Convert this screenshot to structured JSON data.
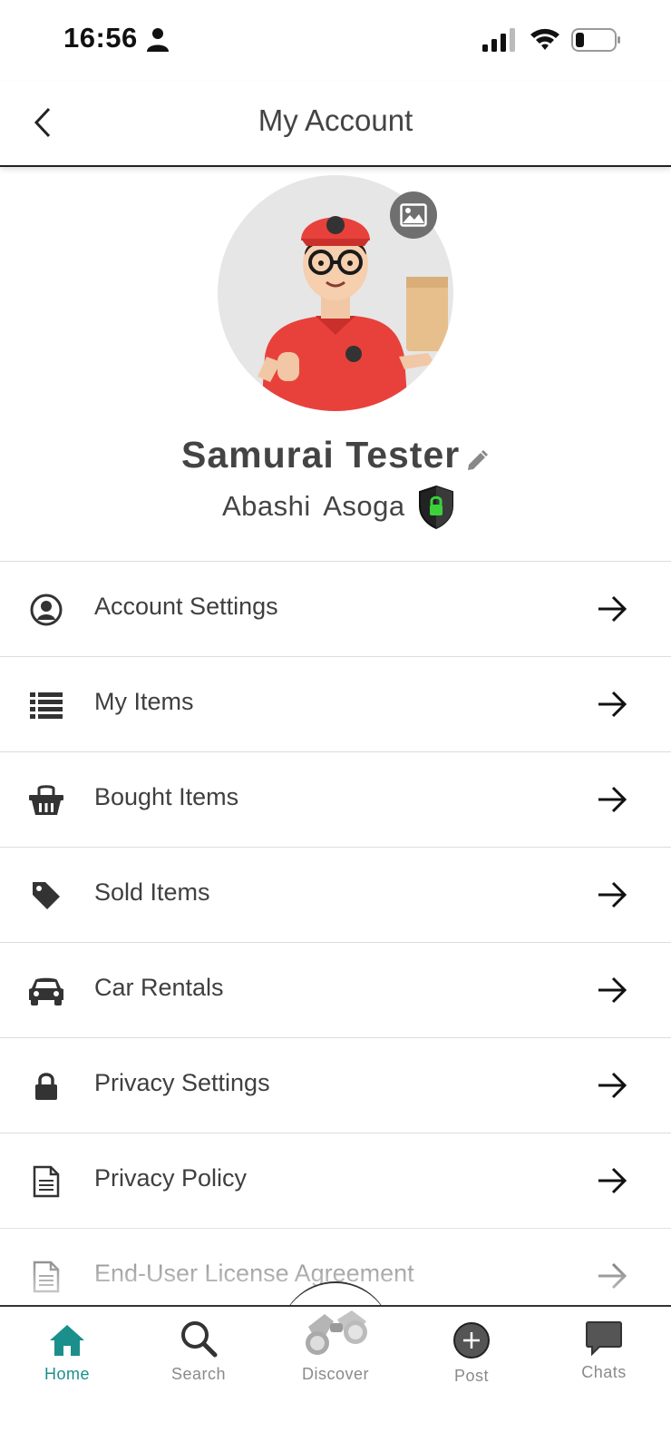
{
  "status_bar": {
    "time": "16:56"
  },
  "header": {
    "title": "My Account",
    "back_icon": "chevron-left-icon"
  },
  "profile": {
    "name": "Samurai Tester",
    "location": "Abashi  Asoga",
    "avatar_icon": "avatar-illustration",
    "verified_icon": "shield-lock-icon"
  },
  "menu": {
    "items": [
      {
        "label": "Account Settings",
        "icon": "user-circle-icon"
      },
      {
        "label": "My Items",
        "icon": "list-icon"
      },
      {
        "label": "Bought Items",
        "icon": "basket-icon"
      },
      {
        "label": "Sold Items",
        "icon": "tag-icon"
      },
      {
        "label": "Car Rentals",
        "icon": "car-icon"
      },
      {
        "label": "Privacy Settings",
        "icon": "lock-icon"
      },
      {
        "label": "Privacy Policy",
        "icon": "document-icon"
      },
      {
        "label": "End-User License Agreement",
        "icon": "document-icon"
      }
    ]
  },
  "tab_bar": {
    "home": "Home",
    "search": "Search",
    "discover": "Discover",
    "post": "Post",
    "chats": "Chats",
    "active_color": "#1b8f8c",
    "inactive_color": "#8a8a8a"
  }
}
